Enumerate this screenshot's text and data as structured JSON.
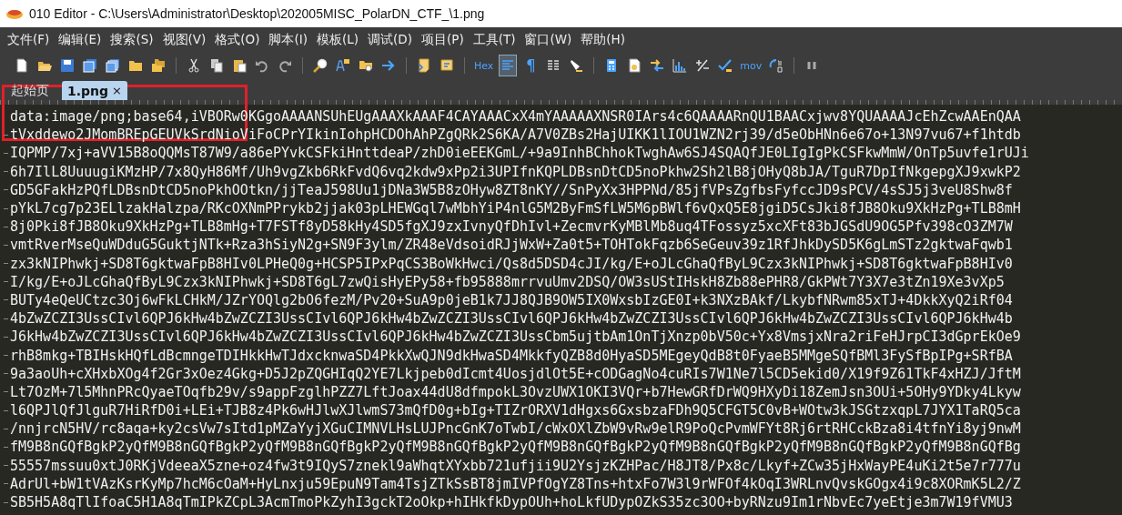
{
  "window": {
    "title": "010 Editor - C:\\Users\\Administrator\\Desktop\\202005MISC_PolarDN_CTF_\\1.png"
  },
  "menu": [
    "文件(F)",
    "编辑(E)",
    "搜索(S)",
    "视图(V)",
    "格式(O)",
    "脚本(I)",
    "模板(L)",
    "调试(D)",
    "项目(P)",
    "工具(T)",
    "窗口(W)",
    "帮助(H)"
  ],
  "toolbar": [
    {
      "kind": "icon",
      "pressed": false
    },
    {
      "kind": "icon",
      "pressed": false
    },
    {
      "kind": "icon",
      "pressed": false
    },
    {
      "kind": "icon",
      "pressed": false
    },
    {
      "kind": "icon",
      "pressed": false
    },
    {
      "kind": "icon",
      "pressed": false
    },
    {
      "kind": "icon",
      "pressed": false
    },
    {
      "kind": "separator"
    },
    {
      "kind": "icon",
      "pressed": false
    },
    {
      "kind": "icon",
      "pressed": false
    },
    {
      "kind": "icon",
      "pressed": false
    },
    {
      "kind": "icon",
      "pressed": false
    },
    {
      "kind": "icon",
      "pressed": false
    },
    {
      "kind": "separator"
    },
    {
      "kind": "icon",
      "pressed": false
    },
    {
      "kind": "icon",
      "pressed": false
    },
    {
      "kind": "icon",
      "pressed": false
    },
    {
      "kind": "icon",
      "pressed": false
    },
    {
      "kind": "separator"
    },
    {
      "kind": "icon",
      "pressed": false
    },
    {
      "kind": "icon",
      "pressed": false
    },
    {
      "kind": "separator"
    },
    {
      "kind": "text",
      "label": "Hex",
      "pressed": false
    },
    {
      "kind": "icon",
      "pressed": true
    },
    {
      "kind": "text",
      "label": "¶",
      "pressed": false
    },
    {
      "kind": "icon",
      "pressed": false
    },
    {
      "kind": "icon",
      "pressed": false
    },
    {
      "kind": "separator"
    },
    {
      "kind": "icon",
      "pressed": false
    },
    {
      "kind": "icon",
      "pressed": false
    },
    {
      "kind": "icon",
      "pressed": false
    },
    {
      "kind": "icon",
      "pressed": false
    },
    {
      "kind": "icon",
      "pressed": false
    },
    {
      "kind": "icon",
      "pressed": false
    },
    {
      "kind": "text",
      "label": "mov",
      "pressed": false
    },
    {
      "kind": "icon",
      "pressed": false
    },
    {
      "kind": "separator"
    },
    {
      "kind": "icon",
      "pressed": false
    }
  ],
  "tabs": [
    {
      "label": "起始页",
      "selected": false
    },
    {
      "label": "1.png",
      "selected": true,
      "close": "×"
    }
  ],
  "editor": {
    "lines": [
      {
        "text": "data:image/png;base64,iVBORw0KGgoAAAANSUhEUgAAAXkAAAF4CAYAAACxX4mYAAAAAXNSR0IArs4c6QAAAARnQU1BAACxjwv8YQUAAAAJcEhZcwAAEnQAA",
        "wrapped": false
      },
      {
        "text": "tVxddewo2JMomBREpGEUVkSrdNioViFoCPrYIkinIohpHCDOhAhPZgQRk2S6KA/A7V0ZBs2HajUIKK1lIOU1WZN2rj39/d5eObHNn6e67o+13N97vu67+f1htdb",
        "wrapped": true
      },
      {
        "text": "IQPMP/7xj+aVV15B8oQQMsT87W9/a86ePYvkCSFkiHnttdeaP/zhD0ieEEKGmL/+9a9InhBChhokTwghAw6SJ4SQAQfJE0LIgIgPkCSFkwMmW/OnTp5uvfe1rUJi",
        "wrapped": true
      },
      {
        "text": "6h7IlL8UuuugiKMzHP/7x8QyH86Mf/Uh9vgZkb6RkFvdQ6vq2kdw9xPp2i3UPIfnKQPLDBsnDtCD5noPkhw2Sh2lB8jOHyQ8bJA/TguR7DpIfNkgepgXJ9xwkP2",
        "wrapped": true
      },
      {
        "text": "GD5GFakHzPQfLDBsnDtCD5noPkhOOtkn/jjTeaJ598Uu1jDNa3W5B8zOHyw8ZT8nKY//SnPyXx3HPPNd/85jfVPsZgfbsFyfccJD9sPCV/4sSJ5j3veU8Shw8f",
        "wrapped": true
      },
      {
        "text": "pYkL7cg7p23ELlzakHalzpa/RKcOXNmPPrykb2jjak03pLHEWGql7wMbhYiP4nlG5M2ByFmSfLW5M6pBWlf6vQxQ5E8jgiD5CsJki8fJB8Oku9XkHzPg+TLB8mH",
        "wrapped": true
      },
      {
        "text": "8j0Pki8fJB8Oku9XkHzPg+TLB8mHg+T7FSTf8yD58kHy4SD5fgXJ9zxIvnyQfDhIvl+ZecmvrKyMBlMb8uq4TFossyz5xcXFt83bJGSdU9OG5Pfv398cO3ZM7W",
        "wrapped": true
      },
      {
        "text": "vmtRverMseQuWDduG5GuktjNTk+Rza3hSiyN2g+SN9F3ylm/ZR48eVdsoidRJjWxW+Za0t5+TOHTokFqzb6SeGeuv39z1RfJhkDySD5K6gLmSTz2gktwaFqwb1",
        "wrapped": true
      },
      {
        "text": "zx3kNIPhwkj+SD8T6gktwaFpB8HIv0LPHeQ0g+HCSP5IPxPqCS3BoWkHwci/Qs8d5DSD4cJI/kg/E+oJLcGhaQfByL9Czx3kNIPhwkj+SD8T6gktwaFpB8HIv0",
        "wrapped": true
      },
      {
        "text": "I/kg/E+oJLcGhaQfByL9Czx3kNIPhwkj+SD8T6gL7zwQisHyEPy58+fb95888mrrvuUmv2DSQ/OW3sUStIHskH8Zb88ePHR8/GkPWt7Y3X7e3tZn19Xe3vXp5",
        "wrapped": true
      },
      {
        "text": "BUTy4eQeUCtzc3Oj6wFkLCHkM/JZrYOQlg2bO6fezM/Pv20+SuA9p0jeB1k7JJ8QJB9OW5IX0WxsbIzGE0I+k3NXzBAkf/LkybfNRwm85xTJ+4DkkXyQ2iRf04",
        "wrapped": true
      },
      {
        "text": "4bZwZCZI3UssCIvl6QPJ6kHw4bZwZCZI3UssCIvl6QPJ6kHw4bZwZCZI3UssCIvl6QPJ6kHw4bZwZCZI3UssCIvl6QPJ6kHw4bZwZCZI3UssCIvl6QPJ6kHw4b",
        "wrapped": true
      },
      {
        "text": "J6kHw4bZwZCZI3UssCIvl6QPJ6kHw4bZwZCZI3UssCIvl6QPJ6kHw4bZwZCZI3UssCbm5ujtbAm1OnTjXnzp0bV50c+Yx8VmsjxNra2riFeHJrpCI3dGprEkOe9",
        "wrapped": true
      },
      {
        "text": "rhB8mkg+TBIHskHQfLdBcmngeTDIHkkHwTJdxcknwaSD4PkkXwQJN9dkHwaSD4MkkfyQZB8d0HyaSD5MEgeyQdB8t0FyaeB5MMgeSQfBMl3FySfBpIPg+SRfBA",
        "wrapped": true
      },
      {
        "text": "9a3aoUh+cXHxbXOg4f2Gr3xOez4Gkg+D5J2pZQGHIqQ2YE7Lkjpeb0dIcmt4UosjdlOt5E+cODGagNo4cuRIs7W1Ne7l5CD5ekid0/X19f9Z61TkF4xHZJ/JftM",
        "wrapped": true
      },
      {
        "text": "Lt7OzM+7l5MhnPRcQyaeTOqfb29v/s9appFzglhPZZ7LftJoax44dU8dfmpokL3OvzUWX1OKI3VQr+b7HewGRfDrWQ9HXyDi18ZemJsn3OUi+5OHy9YDky4Lkyw",
        "wrapped": true
      },
      {
        "text": "l6QPJlQfJlguR7HiRfD0i+LEi+TJB8z4Pk6wHJlwXJlwmS73mQfD0g+bIg+TIZrORXV1dHgxs6GxsbzaFDh9Q5CFGT5C0vB+WOtw3kJSGtzxqpL7JYX1TaRQ5ca",
        "wrapped": true
      },
      {
        "text": "/nnjrcN5HV/rc8aqa+ky2csVw7sItd1pMZaYyjXGuCIMNVLHsLUJPncGnK7oTwbI/cWxOXlZbW9vRw9elR9PoQcPvmWFYt8Rj6rtRHCckBza8i4tfnYi8yj9nwM",
        "wrapped": true
      },
      {
        "text": "fM9B8nGQfBgkP2yQfM9B8nGQfBgkP2yQfM9B8nGQfBgkP2yQfM9B8nGQfBgkP2yQfM9B8nGQfBgkP2yQfM9B8nGQfBgkP2yQfM9B8nGQfBgkP2yQfM9B8nGQfBg",
        "wrapped": true
      },
      {
        "text": "55557mssuu0xtJ0RKjVdeeaX5zne+oz4fw3t9IQyS7znekl9aWhqtXYxbb721ufjii9U2YsjzKZHPac/H8JT8/Px8c/Lkyf+ZCw35jHxWayPE4uKi2t5e7r777u",
        "wrapped": true
      },
      {
        "text": "AdrUl+bW1tVAzKsrKyMp7hcM6cOaM+HyLnxju59EpuN9Tam4TsjZTkSsBT8jmIVPfOgYZ8Tns+htxFo7W3l9rWFOf4kOqI3WRLnvQvskGOgx4i9c8XORmK5L2/Z",
        "wrapped": true
      },
      {
        "text": "SB5H5A8qTlIfoaC5H1A8qTmIPkZCpL3AcmTmoPkZyhI3gckT2oOkp+hIHkfkDypOUh+hoLkfUDypOZkS35zc3OO+byRNzu9Im1rNbvEc7yeEtje3m7W19fVMU3",
        "wrapped": true
      }
    ]
  }
}
